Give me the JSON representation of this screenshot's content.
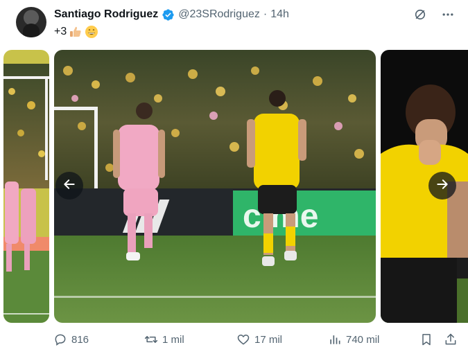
{
  "author": {
    "name": "Santiago Rodriguez",
    "handle": "@23SRodriguez",
    "separator": "·",
    "time": "14h"
  },
  "tweet": {
    "text": "+3"
  },
  "actions": {
    "replies": "816",
    "reposts": "1 mil",
    "likes": "17 mil",
    "views": "740 mil"
  },
  "colors": {
    "verified": "#1d9bf0",
    "muted": "#536471",
    "nav_button": "#0f1419"
  },
  "icons": [
    "verified-badge-icon",
    "grok-icon",
    "more-icon",
    "thumbs-up-emoji",
    "grinning-emoji",
    "chevron-left-icon",
    "chevron-right-icon",
    "reply-icon",
    "repost-icon",
    "like-icon",
    "views-icon",
    "bookmark-icon",
    "share-icon"
  ]
}
